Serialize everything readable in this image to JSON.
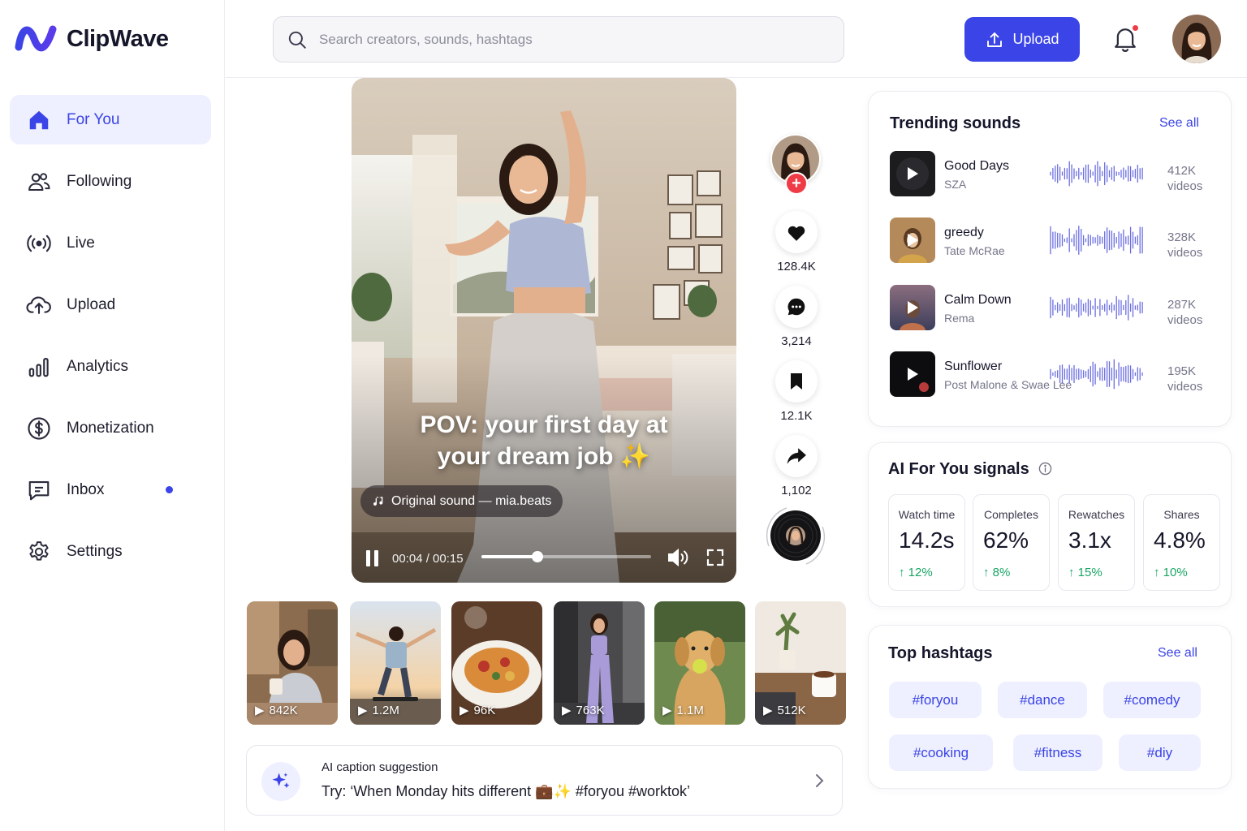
{
  "app": {
    "name": "ClipWave",
    "brand_color": "#3b44e6"
  },
  "sidebar": {
    "items": [
      {
        "label": "For You",
        "icon": "home-icon",
        "active": true
      },
      {
        "label": "Following",
        "icon": "people-icon"
      },
      {
        "label": "Live",
        "icon": "broadcast-icon"
      },
      {
        "label": "Upload",
        "icon": "cloud-upload-icon"
      },
      {
        "label": "Analytics",
        "icon": "bar-chart-icon"
      },
      {
        "label": "Monetization",
        "icon": "dollar-icon"
      },
      {
        "label": "Inbox",
        "icon": "message-icon",
        "unread_dot": true
      },
      {
        "label": "Settings",
        "icon": "gear-icon"
      }
    ]
  },
  "topbar": {
    "search_placeholder": "Search creators, sounds, hashtags",
    "upload_label": "Upload",
    "notification_dot_color": "#ef3b45"
  },
  "video": {
    "caption": "POV: your first day at your dream job ✨",
    "sound": "Original sound — mia.beats",
    "time": "00:04 / 00:15",
    "progress": 0.33
  },
  "actions": {
    "likes": "128.4K",
    "comments": "3,214",
    "saves": "12.1K",
    "shares": "1,102"
  },
  "thumbnails": [
    {
      "count": "842K"
    },
    {
      "count": "1.2M"
    },
    {
      "count": "96K"
    },
    {
      "count": "763K"
    },
    {
      "count": "1.1M"
    },
    {
      "count": "512K"
    }
  ],
  "ai_caption": {
    "title": "AI caption suggestion",
    "text": "Try: ‘When Monday hits different 💼✨ #foryou #worktok’"
  },
  "trending": {
    "title": "Trending sounds",
    "see_all": "See all",
    "items": [
      {
        "title": "Good Days",
        "artist": "SZA",
        "count": "412K",
        "unit": "videos"
      },
      {
        "title": "greedy",
        "artist": "Tate McRae",
        "count": "328K",
        "unit": "videos"
      },
      {
        "title": "Calm Down",
        "artist": "Rema",
        "count": "287K",
        "unit": "videos"
      },
      {
        "title": "Sunflower",
        "artist": "Post Malone & Swae Lee",
        "count": "195K",
        "unit": "videos"
      }
    ]
  },
  "signals": {
    "title": "AI For You signals",
    "items": [
      {
        "label": "Watch time",
        "value": "14.2s",
        "delta": "12%"
      },
      {
        "label": "Completes",
        "value": "62%",
        "delta": "8%"
      },
      {
        "label": "Rewatches",
        "value": "3.1x",
        "delta": "15%"
      },
      {
        "label": "Shares",
        "value": "4.8%",
        "delta": "10%"
      }
    ]
  },
  "hashtags": {
    "title": "Top hashtags",
    "see_all": "See all",
    "items": [
      "#foryou",
      "#dance",
      "#comedy",
      "#cooking",
      "#fitness",
      "#diy"
    ]
  }
}
